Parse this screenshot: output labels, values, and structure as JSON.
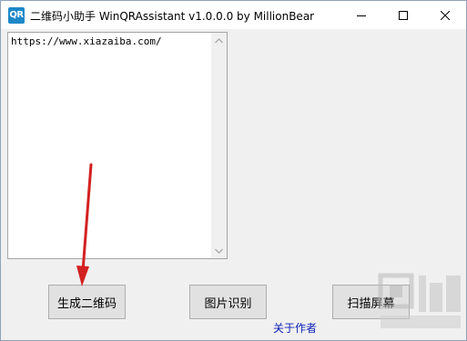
{
  "window": {
    "title": "二维码小助手 WinQRAssistant v1.0.0.0   by MillionBear",
    "icon_text": "QR",
    "icon": "qr-app-icon"
  },
  "controls": {
    "minimize": "minimize-icon",
    "maximize": "maximize-icon",
    "close": "close-icon"
  },
  "input": {
    "value": "https://www.xiazaiba.com/"
  },
  "buttons": {
    "generate": "生成二维码",
    "recognize": "图片识别",
    "scan": "扫描屏幕"
  },
  "about": "关于作者",
  "colors": {
    "annotation_arrow": "#d32020",
    "link": "#0a1fb5"
  }
}
